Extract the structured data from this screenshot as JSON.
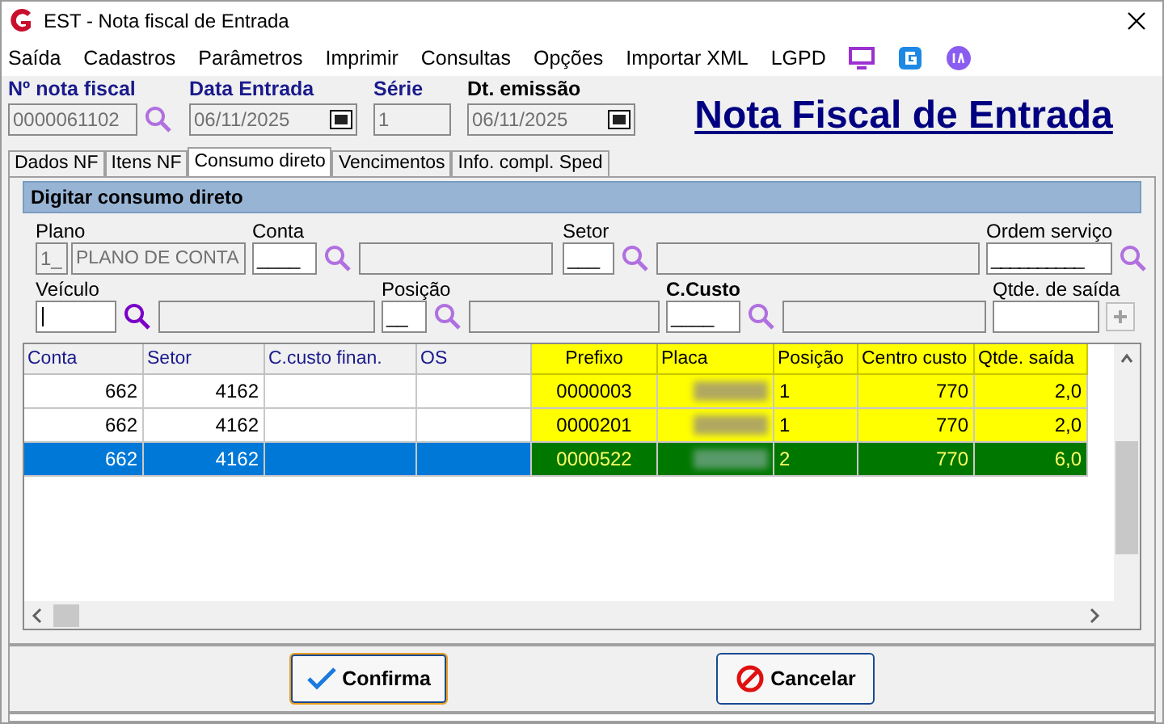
{
  "window": {
    "title": "EST - Nota fiscal de Entrada"
  },
  "menu": [
    "Saída",
    "Cadastros",
    "Parâmetros",
    "Imprimir",
    "Consultas",
    "Opções",
    "Importar XML",
    "LGPD"
  ],
  "header": {
    "fields": [
      {
        "label": "Nº nota fiscal",
        "value": "0000061102",
        "kind": "search"
      },
      {
        "label": "Data Entrada",
        "value": "06/11/2025",
        "kind": "date"
      },
      {
        "label": "Série",
        "value": "1",
        "kind": "plain"
      },
      {
        "label": "Dt. emissão",
        "value": "06/11/2025",
        "kind": "date"
      }
    ],
    "big_title": "Nota Fiscal de Entrada"
  },
  "tabs": [
    {
      "label": "Dados NF",
      "selected": false
    },
    {
      "label": "Itens NF",
      "selected": false
    },
    {
      "label": "Consumo direto",
      "selected": true
    },
    {
      "label": "Vencimentos",
      "selected": false
    },
    {
      "label": "Info. compl. Sped",
      "selected": false
    }
  ],
  "panel": {
    "title": "Digitar consumo direto",
    "plano": {
      "label": "Plano",
      "code": "1_",
      "name": "PLANO DE CONTA"
    },
    "conta": {
      "label": "Conta",
      "value": "____"
    },
    "setor": {
      "label": "Setor",
      "value": "___"
    },
    "ordem": {
      "label": "Ordem serviço",
      "value": "__________"
    },
    "veiculo": {
      "label": "Veículo"
    },
    "posicao": {
      "label": "Posição",
      "value": "__"
    },
    "ccusto": {
      "label": "C.Custo",
      "value": "____"
    },
    "qtde": {
      "label": "Qtde. de saída"
    }
  },
  "table": {
    "columns": [
      {
        "label": "Conta",
        "highlight": false
      },
      {
        "label": "Setor",
        "highlight": false
      },
      {
        "label": "C.custo finan.",
        "highlight": false
      },
      {
        "label": "OS",
        "highlight": false
      },
      {
        "label": "Prefixo",
        "highlight": true
      },
      {
        "label": "Placa",
        "highlight": true
      },
      {
        "label": "Posição",
        "highlight": true
      },
      {
        "label": "Centro custo",
        "highlight": true
      },
      {
        "label": "Qtde. saída",
        "highlight": true
      }
    ],
    "rows": [
      {
        "selected": false,
        "cells": [
          "662",
          "4162",
          "",
          "",
          "0000003",
          "",
          "1",
          "770",
          "2,0"
        ]
      },
      {
        "selected": false,
        "cells": [
          "662",
          "4162",
          "",
          "",
          "0000201",
          "",
          "1",
          "770",
          "2,0"
        ]
      },
      {
        "selected": true,
        "cells": [
          "662",
          "4162",
          "",
          "",
          "0000522",
          "",
          "2",
          "770",
          "6,0"
        ]
      }
    ]
  },
  "buttons": [
    {
      "label": "Confirma",
      "kind": "ok",
      "focused": true
    },
    {
      "label": "Cancelar",
      "kind": "cancel",
      "focused": false
    }
  ]
}
